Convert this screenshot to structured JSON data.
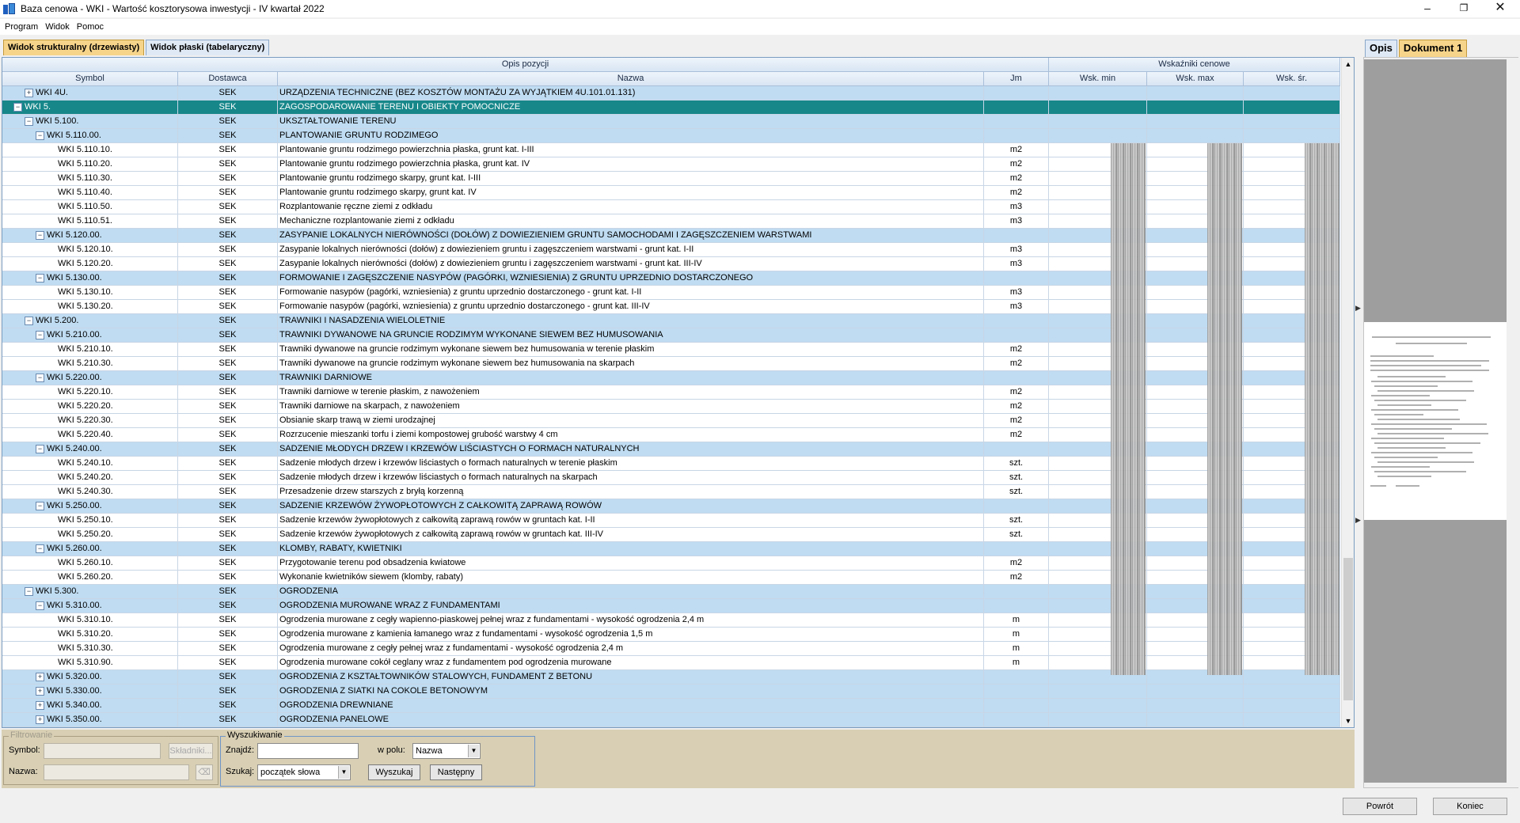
{
  "window": {
    "title": "Baza cenowa - WKI - Wartość kosztorysowa inwestycji - IV kwartał 2022",
    "min_glyph": "–",
    "max_glyph": "❐",
    "close_glyph": "✕"
  },
  "menu": [
    "Program",
    "Widok",
    "Pomoc"
  ],
  "tabs": [
    "Widok strukturalny (drzewiasty)",
    "Widok płaski (tabelaryczny)"
  ],
  "grid": {
    "band_opis": "Opis pozycji",
    "band_wsk": "Wskaźniki cenowe",
    "columns": [
      "Symbol",
      "Dostawca",
      "Nazwa",
      "Jm",
      "Wsk. min",
      "Wsk. max",
      "Wsk. śr."
    ],
    "rows": [
      {
        "sym": "WKI 4U.",
        "lvl": 1,
        "exp": "+",
        "dost": "SEK",
        "naz": "URZĄDZENIA TECHNICZNE (BEZ KOSZTÓW MONTAŻU ZA WYJĄTKIEM 4U.101.01.131)",
        "jm": "",
        "type": "group"
      },
      {
        "sym": "WKI 5.",
        "lvl": 0,
        "exp": "−",
        "dost": "SEK",
        "naz": "ZAGOSPODAROWANIE TERENU I OBIEKTY POMOCNICZE",
        "jm": "",
        "type": "selected"
      },
      {
        "sym": "WKI 5.100.",
        "lvl": 1,
        "exp": "−",
        "dost": "SEK",
        "naz": "UKSZTAŁTOWANIE TERENU",
        "jm": "",
        "type": "group"
      },
      {
        "sym": "WKI 5.110.00.",
        "lvl": 2,
        "exp": "−",
        "dost": "SEK",
        "naz": "PLANTOWANIE GRUNTU RODZIMEGO",
        "jm": "",
        "type": "group"
      },
      {
        "sym": "WKI 5.110.10.",
        "lvl": 3,
        "exp": "",
        "dost": "SEK",
        "naz": "Plantowanie gruntu rodzimego powierzchnia płaska, grunt kat. I-III",
        "jm": "m2",
        "type": "leaf"
      },
      {
        "sym": "WKI 5.110.20.",
        "lvl": 3,
        "exp": "",
        "dost": "SEK",
        "naz": "Plantowanie gruntu rodzimego powierzchnia płaska, grunt kat. IV",
        "jm": "m2",
        "type": "leaf"
      },
      {
        "sym": "WKI 5.110.30.",
        "lvl": 3,
        "exp": "",
        "dost": "SEK",
        "naz": "Plantowanie gruntu rodzimego skarpy, grunt kat. I-III",
        "jm": "m2",
        "type": "leaf"
      },
      {
        "sym": "WKI 5.110.40.",
        "lvl": 3,
        "exp": "",
        "dost": "SEK",
        "naz": "Plantowanie gruntu rodzimego skarpy, grunt kat. IV",
        "jm": "m2",
        "type": "leaf"
      },
      {
        "sym": "WKI 5.110.50.",
        "lvl": 3,
        "exp": "",
        "dost": "SEK",
        "naz": "Rozplantowanie ręczne ziemi z odkładu",
        "jm": "m3",
        "type": "leaf"
      },
      {
        "sym": "WKI 5.110.51.",
        "lvl": 3,
        "exp": "",
        "dost": "SEK",
        "naz": "Mechaniczne rozplantowanie ziemi z odkładu",
        "jm": "m3",
        "type": "leaf"
      },
      {
        "sym": "WKI 5.120.00.",
        "lvl": 2,
        "exp": "−",
        "dost": "SEK",
        "naz": "ZASYPANIE LOKALNYCH NIERÓWNOŚCI (DOŁÓW) Z DOWIEZIENIEM GRUNTU SAMOCHODAMI I ZAGĘSZCZENIEM WARSTWAMI",
        "jm": "",
        "type": "group"
      },
      {
        "sym": "WKI 5.120.10.",
        "lvl": 3,
        "exp": "",
        "dost": "SEK",
        "naz": "Zasypanie lokalnych nierówności (dołów) z dowiezieniem gruntu i zagęszczeniem warstwami - grunt kat. I-II",
        "jm": "m3",
        "type": "leaf"
      },
      {
        "sym": "WKI 5.120.20.",
        "lvl": 3,
        "exp": "",
        "dost": "SEK",
        "naz": "Zasypanie lokalnych nierówności (dołów) z dowiezieniem gruntu i zagęszczeniem warstwami - grunt kat. III-IV",
        "jm": "m3",
        "type": "leaf"
      },
      {
        "sym": "WKI 5.130.00.",
        "lvl": 2,
        "exp": "−",
        "dost": "SEK",
        "naz": "FORMOWANIE I ZAGĘSZCZENIE NASYPÓW (PAGÓRKI, WZNIESIENIA) Z GRUNTU UPRZEDNIO DOSTARCZONEGO",
        "jm": "",
        "type": "group"
      },
      {
        "sym": "WKI 5.130.10.",
        "lvl": 3,
        "exp": "",
        "dost": "SEK",
        "naz": "Formowanie nasypów (pagórki, wzniesienia) z gruntu uprzednio dostarczonego - grunt kat. I-II",
        "jm": "m3",
        "type": "leaf"
      },
      {
        "sym": "WKI 5.130.20.",
        "lvl": 3,
        "exp": "",
        "dost": "SEK",
        "naz": "Formowanie nasypów (pagórki, wzniesienia) z gruntu uprzednio dostarczonego - grunt kat. III-IV",
        "jm": "m3",
        "type": "leaf"
      },
      {
        "sym": "WKI 5.200.",
        "lvl": 1,
        "exp": "−",
        "dost": "SEK",
        "naz": "TRAWNIKI I NASADZENIA WIELOLETNIE",
        "jm": "",
        "type": "group"
      },
      {
        "sym": "WKI 5.210.00.",
        "lvl": 2,
        "exp": "−",
        "dost": "SEK",
        "naz": "TRAWNIKI DYWANOWE NA GRUNCIE RODZIMYM WYKONANE SIEWEM BEZ HUMUSOWANIA",
        "jm": "",
        "type": "group"
      },
      {
        "sym": "WKI 5.210.10.",
        "lvl": 3,
        "exp": "",
        "dost": "SEK",
        "naz": "Trawniki dywanowe na gruncie rodzimym wykonane siewem bez humusowania w terenie płaskim",
        "jm": "m2",
        "type": "leaf"
      },
      {
        "sym": "WKI 5.210.30.",
        "lvl": 3,
        "exp": "",
        "dost": "SEK",
        "naz": "Trawniki dywanowe na gruncie rodzimym wykonane siewem bez humusowania na skarpach",
        "jm": "m2",
        "type": "leaf"
      },
      {
        "sym": "WKI 5.220.00.",
        "lvl": 2,
        "exp": "−",
        "dost": "SEK",
        "naz": "TRAWNIKI DARNIOWE",
        "jm": "",
        "type": "group"
      },
      {
        "sym": "WKI 5.220.10.",
        "lvl": 3,
        "exp": "",
        "dost": "SEK",
        "naz": "Trawniki darniowe w terenie płaskim, z nawożeniem",
        "jm": "m2",
        "type": "leaf"
      },
      {
        "sym": "WKI 5.220.20.",
        "lvl": 3,
        "exp": "",
        "dost": "SEK",
        "naz": "Trawniki darniowe na skarpach, z nawożeniem",
        "jm": "m2",
        "type": "leaf"
      },
      {
        "sym": "WKI 5.220.30.",
        "lvl": 3,
        "exp": "",
        "dost": "SEK",
        "naz": "Obsianie skarp trawą w ziemi urodzajnej",
        "jm": "m2",
        "type": "leaf"
      },
      {
        "sym": "WKI 5.220.40.",
        "lvl": 3,
        "exp": "",
        "dost": "SEK",
        "naz": "Rozrzucenie mieszanki torfu i ziemi kompostowej grubość warstwy 4 cm",
        "jm": "m2",
        "type": "leaf"
      },
      {
        "sym": "WKI 5.240.00.",
        "lvl": 2,
        "exp": "−",
        "dost": "SEK",
        "naz": "SADZENIE MŁODYCH DRZEW I KRZEWÓW LIŚCIASTYCH O FORMACH NATURALNYCH",
        "jm": "",
        "type": "group"
      },
      {
        "sym": "WKI 5.240.10.",
        "lvl": 3,
        "exp": "",
        "dost": "SEK",
        "naz": "Sadzenie młodych drzew i krzewów liściastych o formach naturalnych w terenie płaskim",
        "jm": "szt.",
        "type": "leaf"
      },
      {
        "sym": "WKI 5.240.20.",
        "lvl": 3,
        "exp": "",
        "dost": "SEK",
        "naz": "Sadzenie młodych drzew i krzewów liściastych o formach naturalnych na skarpach",
        "jm": "szt.",
        "type": "leaf"
      },
      {
        "sym": "WKI 5.240.30.",
        "lvl": 3,
        "exp": "",
        "dost": "SEK",
        "naz": "Przesadzenie drzew starszych z bryłą korzenną",
        "jm": "szt.",
        "type": "leaf"
      },
      {
        "sym": "WKI 5.250.00.",
        "lvl": 2,
        "exp": "−",
        "dost": "SEK",
        "naz": "SADZENIE KRZEWÓW ŻYWOPŁOTOWYCH Z CAŁKOWITĄ ZAPRAWĄ ROWÓW",
        "jm": "",
        "type": "group"
      },
      {
        "sym": "WKI 5.250.10.",
        "lvl": 3,
        "exp": "",
        "dost": "SEK",
        "naz": "Sadzenie krzewów żywopłotowych z całkowitą zaprawą rowów w gruntach kat. I-II",
        "jm": "szt.",
        "type": "leaf"
      },
      {
        "sym": "WKI 5.250.20.",
        "lvl": 3,
        "exp": "",
        "dost": "SEK",
        "naz": "Sadzenie krzewów żywopłotowych z całkowitą zaprawą rowów w gruntach kat. III-IV",
        "jm": "szt.",
        "type": "leaf"
      },
      {
        "sym": "WKI 5.260.00.",
        "lvl": 2,
        "exp": "−",
        "dost": "SEK",
        "naz": "KLOMBY, RABATY, KWIETNIKI",
        "jm": "",
        "type": "group"
      },
      {
        "sym": "WKI 5.260.10.",
        "lvl": 3,
        "exp": "",
        "dost": "SEK",
        "naz": "Przygotowanie terenu pod obsadzenia kwiatowe",
        "jm": "m2",
        "type": "leaf"
      },
      {
        "sym": "WKI 5.260.20.",
        "lvl": 3,
        "exp": "",
        "dost": "SEK",
        "naz": "Wykonanie kwietników siewem (klomby, rabaty)",
        "jm": "m2",
        "type": "leaf"
      },
      {
        "sym": "WKI 5.300.",
        "lvl": 1,
        "exp": "−",
        "dost": "SEK",
        "naz": "OGRODZENIA",
        "jm": "",
        "type": "group"
      },
      {
        "sym": "WKI 5.310.00.",
        "lvl": 2,
        "exp": "−",
        "dost": "SEK",
        "naz": "OGRODZENIA MUROWANE WRAZ Z FUNDAMENTAMI",
        "jm": "",
        "type": "group"
      },
      {
        "sym": "WKI 5.310.10.",
        "lvl": 3,
        "exp": "",
        "dost": "SEK",
        "naz": "Ogrodzenia murowane z cegły wapienno-piaskowej pełnej wraz z fundamentami - wysokość ogrodzenia 2,4 m",
        "jm": "m",
        "type": "leaf"
      },
      {
        "sym": "WKI 5.310.20.",
        "lvl": 3,
        "exp": "",
        "dost": "SEK",
        "naz": "Ogrodzenia murowane z kamienia łamanego wraz z fundamentami - wysokość ogrodzenia 1,5 m",
        "jm": "m",
        "type": "leaf"
      },
      {
        "sym": "WKI 5.310.30.",
        "lvl": 3,
        "exp": "",
        "dost": "SEK",
        "naz": "Ogrodzenia murowane z cegły pełnej wraz z fundamentami - wysokość ogrodzenia 2,4 m",
        "jm": "m",
        "type": "leaf"
      },
      {
        "sym": "WKI 5.310.90.",
        "lvl": 3,
        "exp": "",
        "dost": "SEK",
        "naz": "Ogrodzenia murowane cokół ceglany wraz z fundamentem pod ogrodzenia murowane",
        "jm": "m",
        "type": "leaf"
      },
      {
        "sym": "WKI 5.320.00.",
        "lvl": 2,
        "exp": "+",
        "dost": "SEK",
        "naz": "OGRODZENIA Z KSZTAŁTOWNIKÓW STALOWYCH, FUNDAMENT Z BETONU",
        "jm": "",
        "type": "group"
      },
      {
        "sym": "WKI 5.330.00.",
        "lvl": 2,
        "exp": "+",
        "dost": "SEK",
        "naz": "OGRODZENIA Z SIATKI NA COKOLE BETONOWYM",
        "jm": "",
        "type": "group"
      },
      {
        "sym": "WKI 5.340.00.",
        "lvl": 2,
        "exp": "+",
        "dost": "SEK",
        "naz": "OGRODZENIA DREWNIANE",
        "jm": "",
        "type": "group"
      },
      {
        "sym": "WKI 5.350.00.",
        "lvl": 2,
        "exp": "+",
        "dost": "SEK",
        "naz": "OGRODZENIA PANELOWE",
        "jm": "",
        "type": "group"
      }
    ]
  },
  "filter": {
    "title": "Filtrowanie",
    "symbol_label": "Symbol:",
    "symbol_value": "",
    "skladniki_label": "Składniki...",
    "nazwa_label": "Nazwa:",
    "nazwa_value": "",
    "clear_label": "⌫"
  },
  "search": {
    "title": "Wyszukiwanie",
    "znajdz_label": "Znajdź:",
    "znajdz_value": "",
    "wpolu_label": "w polu:",
    "wpolu_value": "Nazwa",
    "szukaj_label": "Szukaj:",
    "szukaj_value": "początek słowa",
    "wyszukaj_label": "Wyszukaj",
    "nastepny_label": "Następny"
  },
  "right_tabs": [
    "Opis",
    "Dokument 1"
  ],
  "footer": {
    "back_label": "Powrót",
    "end_label": "Koniec"
  },
  "colors": {
    "selected_row": "#17878a",
    "group_row": "#bfdcf2",
    "active_tab": "#f6d48a"
  }
}
